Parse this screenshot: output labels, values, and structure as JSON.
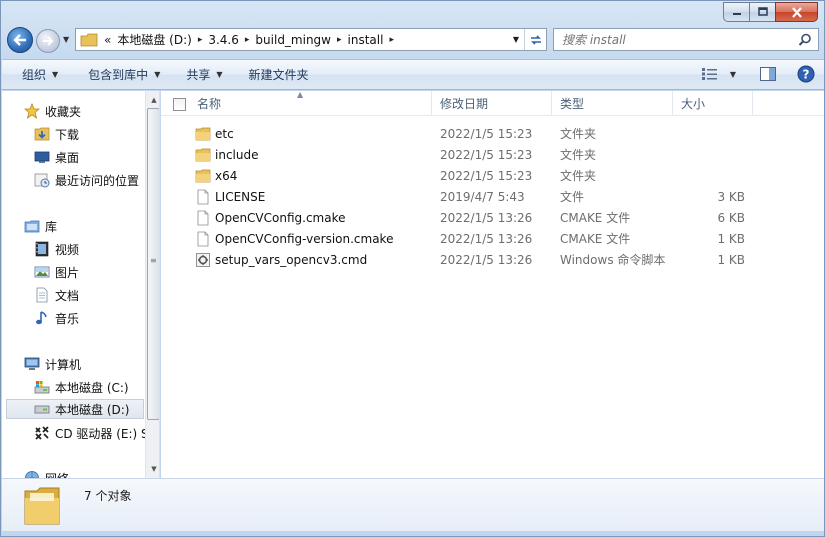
{
  "window": {
    "caption": {
      "minimize": "minimize",
      "maximize": "maximize",
      "close": "close"
    }
  },
  "address": {
    "overflow": "«",
    "crumbs": [
      "本地磁盘 (D:)",
      "3.4.6",
      "build_mingw",
      "install"
    ],
    "separator": "▸"
  },
  "search": {
    "placeholder": "搜索 install"
  },
  "toolbar": {
    "organize": "组织",
    "include_in_library": "包含到库中",
    "share": "共享",
    "new_folder": "新建文件夹"
  },
  "nav": {
    "favorites": "收藏夹",
    "downloads": "下载",
    "desktop": "桌面",
    "recent": "最近访问的位置",
    "libraries": "库",
    "videos": "视频",
    "pictures": "图片",
    "documents": "文档",
    "music": "音乐",
    "computer": "计算机",
    "drive_c": "本地磁盘 (C:)",
    "drive_d": "本地磁盘 (D:)",
    "drive_e": "CD 驱动器 (E:) S",
    "network": "网络"
  },
  "columns": {
    "name": "名称",
    "date": "修改日期",
    "type": "类型",
    "size": "大小"
  },
  "files": [
    {
      "name": "etc",
      "date": "2022/1/5 15:23",
      "type": "文件夹",
      "size": "",
      "icon": "folder-icon"
    },
    {
      "name": "include",
      "date": "2022/1/5 15:23",
      "type": "文件夹",
      "size": "",
      "icon": "folder-icon"
    },
    {
      "name": "x64",
      "date": "2022/1/5 15:23",
      "type": "文件夹",
      "size": "",
      "icon": "folder-icon"
    },
    {
      "name": "LICENSE",
      "date": "2019/4/7 5:43",
      "type": "文件",
      "size": "3 KB",
      "icon": "file-icon"
    },
    {
      "name": "OpenCVConfig.cmake",
      "date": "2022/1/5 13:26",
      "type": "CMAKE 文件",
      "size": "6 KB",
      "icon": "file-icon"
    },
    {
      "name": "OpenCVConfig-version.cmake",
      "date": "2022/1/5 13:26",
      "type": "CMAKE 文件",
      "size": "1 KB",
      "icon": "file-icon"
    },
    {
      "name": "setup_vars_opencv3.cmd",
      "date": "2022/1/5 13:26",
      "type": "Windows 命令脚本",
      "size": "1 KB",
      "icon": "script-icon"
    }
  ],
  "status": {
    "count": "7 个对象"
  }
}
